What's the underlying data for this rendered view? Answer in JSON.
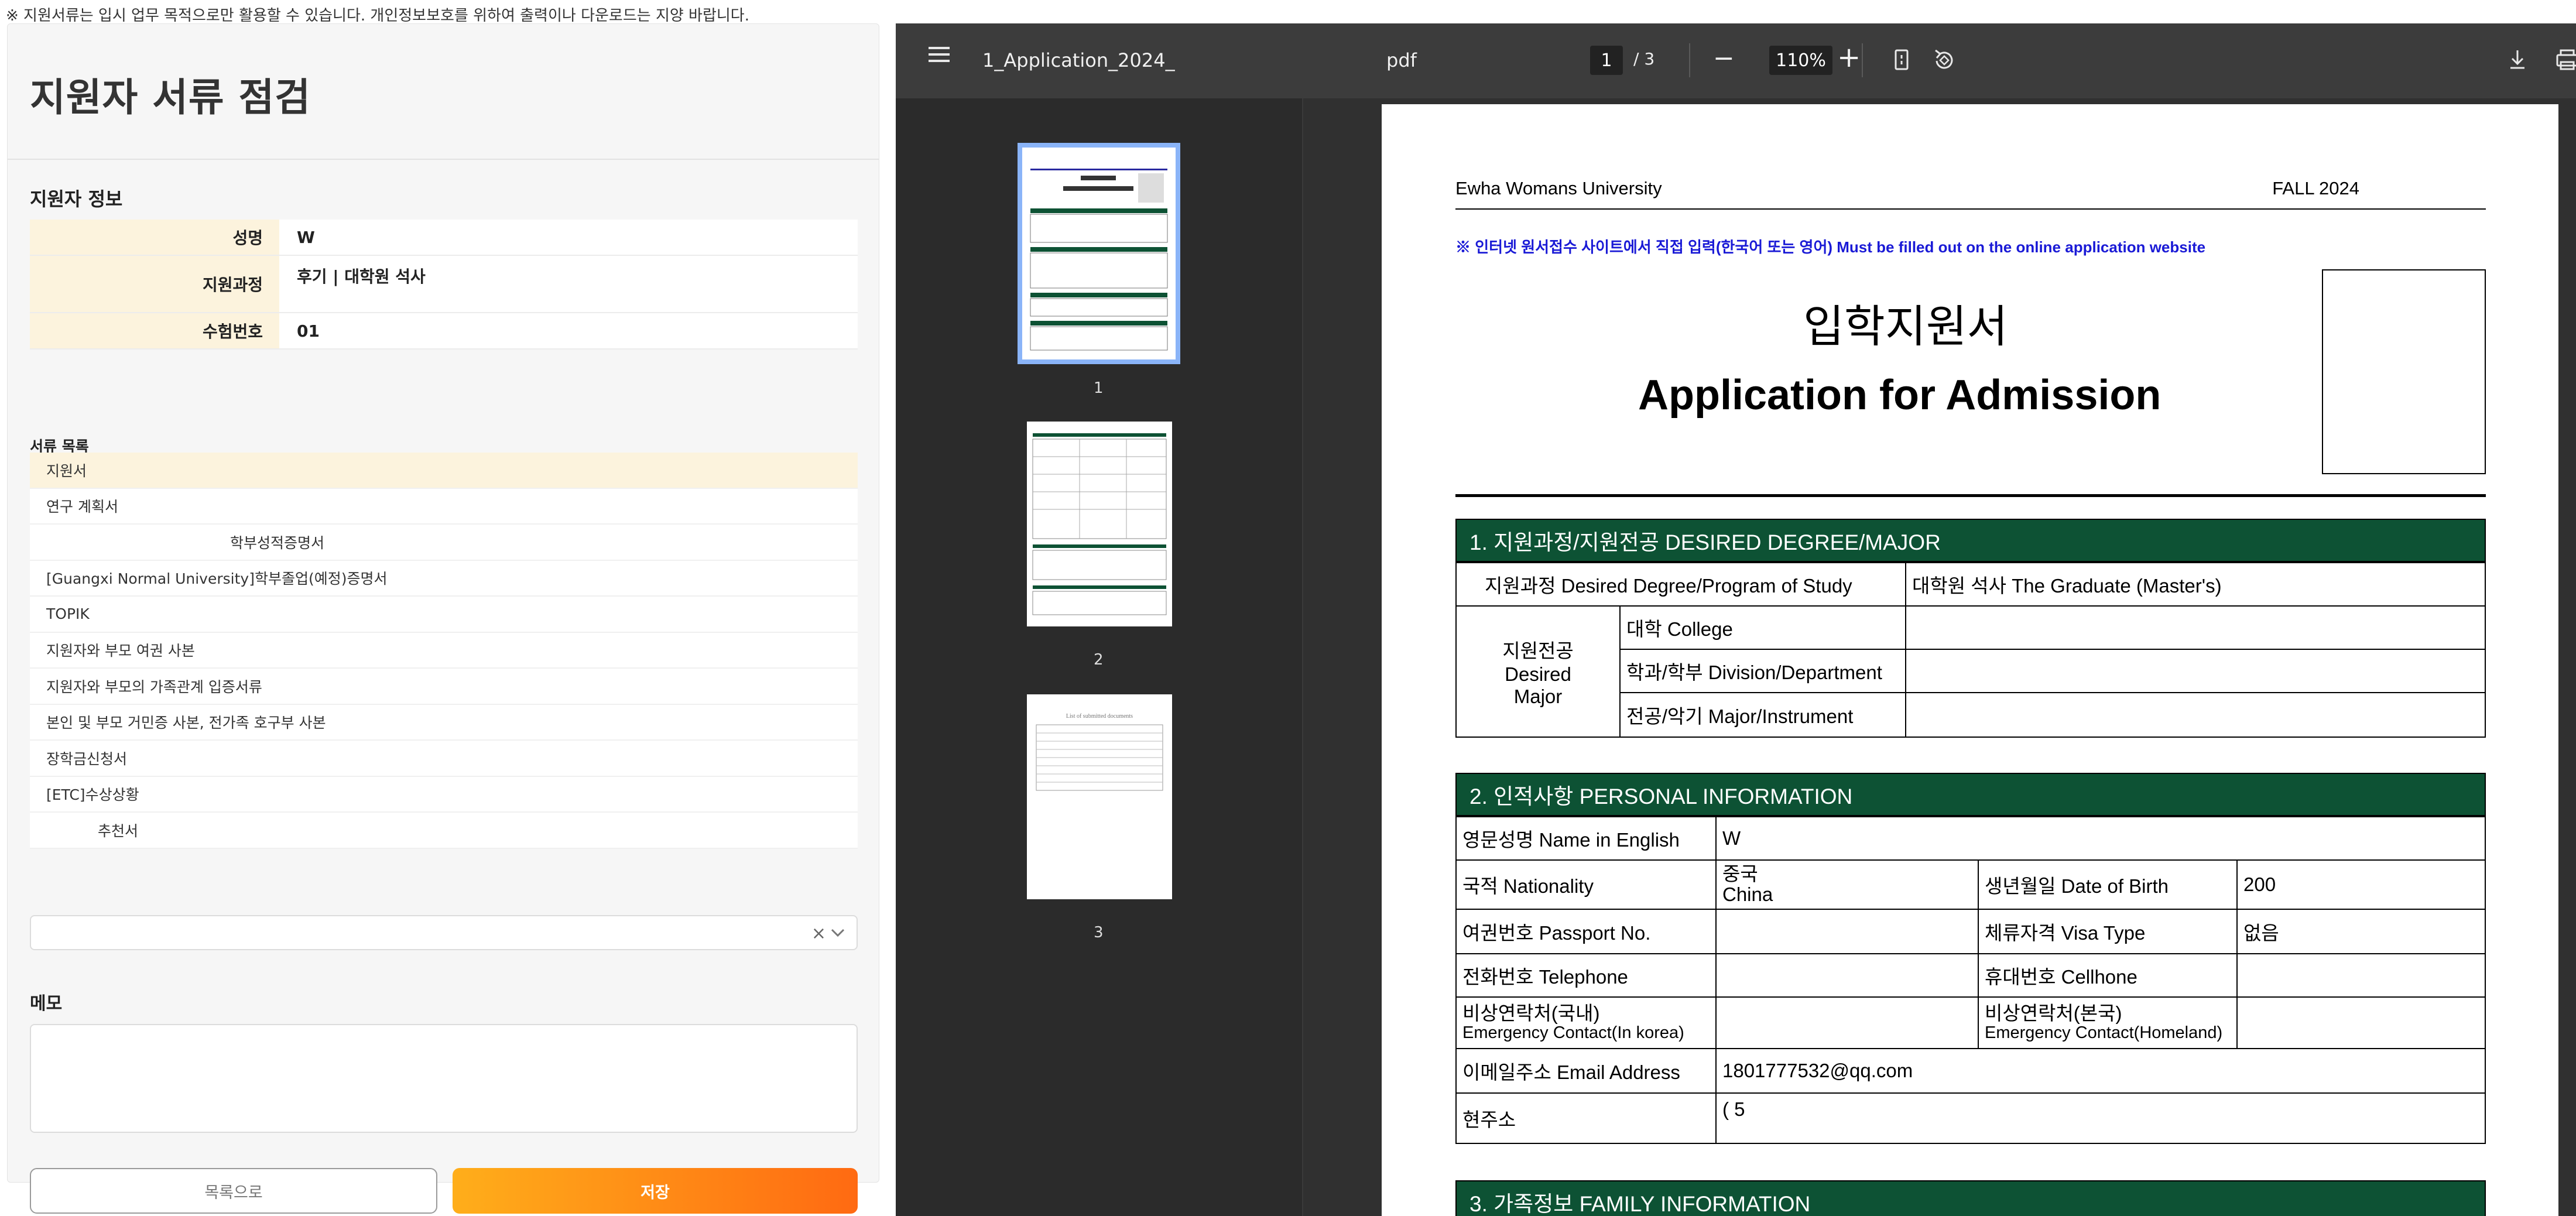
{
  "notice": "※ 지원서류는 입시 업무 목적으로만 활용할 수 있습니다. 개인정보보호를 위하여 출력이나 다운로드는 지양 바랍니다.",
  "panel": {
    "title": "지원자 서류 점검",
    "info_title": "지원자 정보",
    "info": [
      {
        "label": "성명",
        "value": "W"
      },
      {
        "label": "지원과정",
        "value": "후기 | 대학원 석사"
      },
      {
        "label": "수험번호",
        "value": "01"
      }
    ],
    "docs_title": "서류 목록",
    "docs": [
      "지원서",
      "연구 계획서",
      "학부성적증명서",
      "[Guangxi Normal University]학부졸업(예정)증명서",
      "TOPIK",
      "지원자와 부모 여권 사본",
      "지원자와 부모의 가족관계 입증서류",
      "본인 및 부모 거민증 사본, 전가족 호구부 사본",
      "장학금신청서",
      "[ETC]수상상황",
      "추천서"
    ],
    "select_clear": "×",
    "memo_title": "메모",
    "btn_list": "목록으로",
    "btn_save": "저장"
  },
  "viewer": {
    "filename": "1_Application_2024_",
    "ext": "pdf",
    "page_current": "1",
    "page_total": "/  3",
    "zoom": "110%",
    "minus": "−",
    "plus": "+",
    "thumb_labels": [
      "1",
      "2",
      "3"
    ],
    "thumb3_caption": "List of submitted documents",
    "page": {
      "university": "Ewha Womans University",
      "term": "FALL 2024",
      "notice": "※ 인터넷 원서접수 사이트에서 직접 입력(한국어 또는 영어)  Must be filled out on the online application website",
      "title_kor": "입학지원서",
      "title_eng": "Application for Admission",
      "sec1": "1. 지원과정/지원전공  DESIRED DEGREE/MAJOR",
      "degree_label": "지원과정  Desired Degree/Program of Study",
      "degree_value": "대학원 석사  The Graduate (Master's)",
      "major_label_1": "지원전공",
      "major_label_2": "Desired",
      "major_label_3": "Major",
      "college": "대학  College",
      "division": "학과/학부  Division/Department",
      "major": "전공/악기  Major/Instrument",
      "sec2": "2. 인적사항  PERSONAL INFORMATION",
      "name_label": "영문성명  Name in English",
      "name_value": "W",
      "nat_label": "국적  Nationality",
      "nat_value_1": "중국",
      "nat_value_2": "China",
      "dob_label": "생년월일  Date of Birth",
      "dob_value": "200",
      "passport_label": "여권번호  Passport No.",
      "visa_label": "체류자격  Visa Type",
      "visa_value": "없음",
      "tel_label": "전화번호  Telephone",
      "cell_label": "휴대번호  Cellhone",
      "emerg_kr_1": "비상연락처(국내)",
      "emerg_kr_2": "Emergency Contact(In korea)",
      "emerg_home_1": "비상연락처(본국)",
      "emerg_home_2": "Emergency Contact(Homeland)",
      "email_label": "이메일주소 Email Address",
      "email_value": "1801777532@qq.com",
      "addr_label": "현주소",
      "addr_value": "( 5",
      "sec3": "3. 가족정보  FAMILY INFORMATION"
    }
  },
  "colors": {
    "accent_start": "#ffae1a",
    "accent_end": "#ff6a12",
    "highlight": "#fcf3dd",
    "form_header": "#0d5234"
  }
}
